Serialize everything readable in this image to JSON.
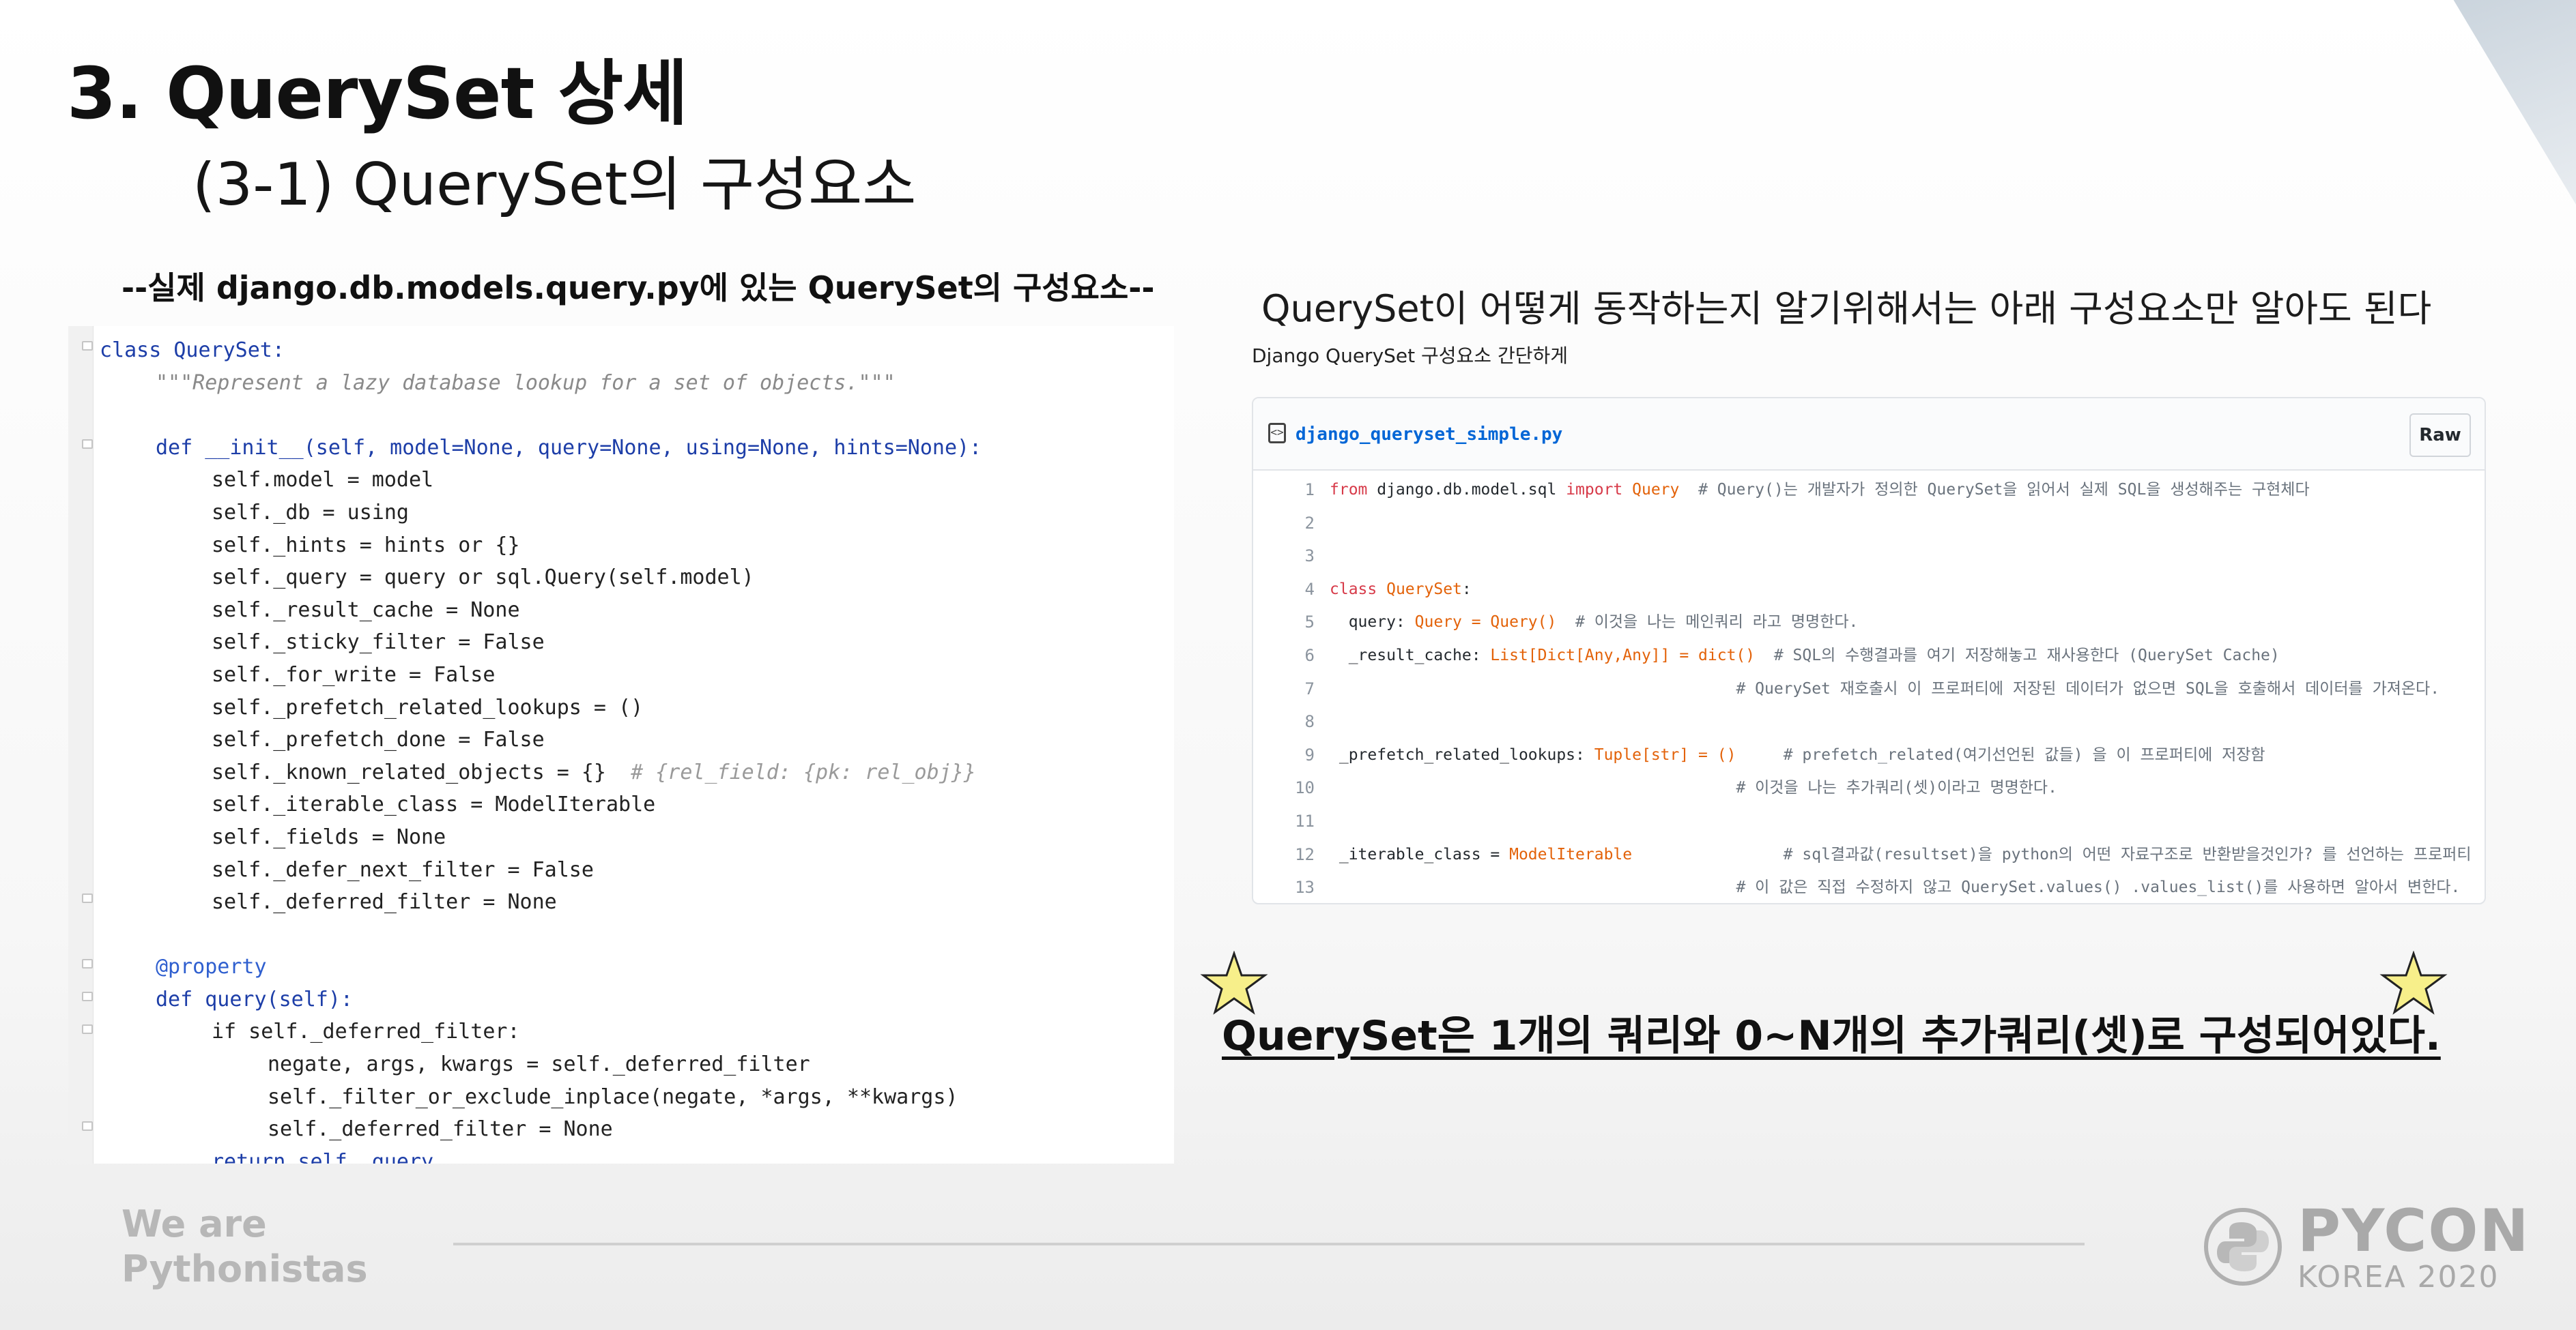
{
  "slide": {
    "title": "3. QuerySet 상세",
    "subtitle": "(3-1) QuerySet의 구성요소"
  },
  "left": {
    "heading": "--실제 django.db.models.query.py에 있는 QuerySet의 구성요소--",
    "code": [
      "class QuerySet:",
      "\"\"\"Represent a lazy database lookup for a set of objects.\"\"\"",
      "",
      "def __init__(self, model=None, query=None, using=None, hints=None):",
      "self.model = model",
      "self._db = using",
      "self._hints = hints or {}",
      "self._query = query or sql.Query(self.model)",
      "self._result_cache = None",
      "self._sticky_filter = False",
      "self._for_write = False",
      "self._prefetch_related_lookups = ()",
      "self._prefetch_done = False",
      "self._known_related_objects = {}",
      "# {rel_field: {pk: rel_obj}}",
      "self._iterable_class = ModelIterable",
      "self._fields = None",
      "self._defer_next_filter = False",
      "self._deferred_filter = None",
      "",
      "@property",
      "def query(self):",
      "if self._deferred_filter:",
      "negate, args, kwargs = self._deferred_filter",
      "self._filter_or_exclude_inplace(negate, *args, **kwargs)",
      "self._deferred_filter = None",
      "return self._query"
    ]
  },
  "right": {
    "heading": "QuerySet이 어떻게 동작하는지 알기위해서는 아래 구성요소만 알아도 된다",
    "subheading": "Django QuerySet 구성요소 간단하게",
    "gist": {
      "filename": "django_queryset_simple.py",
      "raw_label": "Raw",
      "line_numbers": [
        "1",
        "2",
        "3",
        "4",
        "5",
        "6",
        "7",
        "8",
        "9",
        "10",
        "11",
        "12",
        "13"
      ],
      "lines": [
        {
          "a": "from",
          "b": " django.db.model.sql ",
          "c": "import",
          "d": " Query",
          "e": "  # Query()는 개발자가 정의한 QuerySet을 읽어서 실제 SQL을 생성해주는 구현체다"
        },
        {
          "a": "",
          "b": "",
          "c": "",
          "d": "",
          "e": ""
        },
        {
          "a": "",
          "b": "",
          "c": "",
          "d": "",
          "e": ""
        },
        {
          "a": "class",
          "b": " ",
          "c": "",
          "d": "QuerySet",
          "e": ":"
        },
        {
          "a": "",
          "b": "  query: ",
          "c": "",
          "d": "Query = Query()",
          "e": "  # 이것을 나는 메인쿼리 라고 명명한다."
        },
        {
          "a": "",
          "b": "  _result_cache: ",
          "c": "",
          "d": "List[Dict[Any,Any]] = dict()",
          "e": "  # SQL의 수행결과를 여기 저장해놓고 재사용한다 (QuerySet Cache)"
        },
        {
          "a": "",
          "b": "                                           ",
          "c": "",
          "d": "",
          "e": "# QuerySet 재호출시 이 프로퍼티에 저장된 데이터가 없으면 SQL을 호출해서 데이터를 가져온다."
        },
        {
          "a": "",
          "b": "",
          "c": "",
          "d": "",
          "e": ""
        },
        {
          "a": "",
          "b": " _prefetch_related_lookups: ",
          "c": "",
          "d": "Tuple[str] = ()",
          "e": "     # prefetch_related(여기선언된 값들) 을 이 프로퍼티에 저장함"
        },
        {
          "a": "",
          "b": "                                           ",
          "c": "",
          "d": "",
          "e": "# 이것을 나는 추가쿼리(셋)이라고 명명한다."
        },
        {
          "a": "",
          "b": "",
          "c": "",
          "d": "",
          "e": ""
        },
        {
          "a": "",
          "b": " _iterable_class = ",
          "c": "",
          "d": "ModelIterable",
          "e": "                # sql결과값(resultset)을 python의 어떤 자료구조로 반환받을것인가? 를 선언하는 프로퍼티"
        },
        {
          "a": "",
          "b": "                                           ",
          "c": "",
          "d": "",
          "e": "# 이 값은 직접 수정하지 않고 QuerySet.values() .values_list()를 사용하면 알아서 변한다."
        }
      ]
    },
    "summary": "QuerySet은 1개의 쿼리와 0~N개의 추가쿼리(셋)로 구성되어있다."
  },
  "footer": {
    "tagline_line1": "We are",
    "tagline_line2": "Pythonistas",
    "brand": "PYCON",
    "brand_sub": "KOREA 2020"
  },
  "colors": {
    "star_fill": "#f7ef8a",
    "star_stroke": "#222222",
    "link_blue": "#0366d6"
  }
}
